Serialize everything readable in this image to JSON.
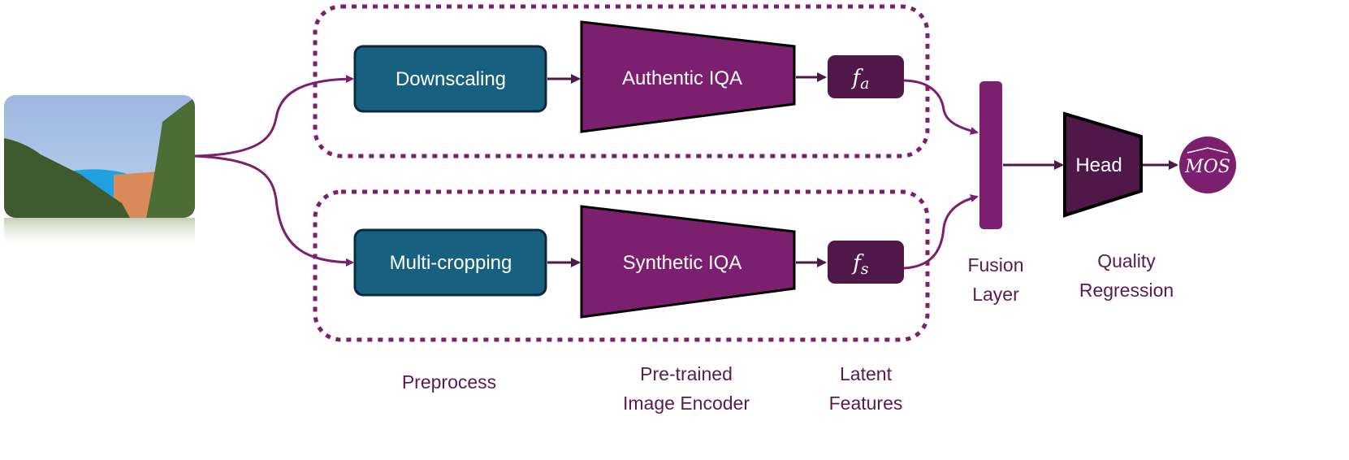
{
  "colors": {
    "accent": "#7b1f6e",
    "dark_purple": "#501849",
    "teal": "#17607f",
    "text": "#5a1a52"
  },
  "input_image": {
    "icon": "photo-coastal-city"
  },
  "blocks": {
    "downscaling": "Downscaling",
    "multi_cropping": "Multi-cropping",
    "authentic_iqa": "Authentic IQA",
    "synthetic_iqa": "Synthetic IQA",
    "f_a": {
      "base": "f",
      "sub": "a"
    },
    "f_s": {
      "base": "f",
      "sub": "s"
    },
    "head": "Head",
    "mos": "MOS"
  },
  "labels": {
    "preprocess": "Preprocess",
    "encoder": [
      "Pre-trained",
      "Image Encoder"
    ],
    "latent": [
      "Latent",
      "Features"
    ],
    "fusion": [
      "Fusion",
      "Layer"
    ],
    "regression": [
      "Quality",
      "Regression"
    ]
  }
}
